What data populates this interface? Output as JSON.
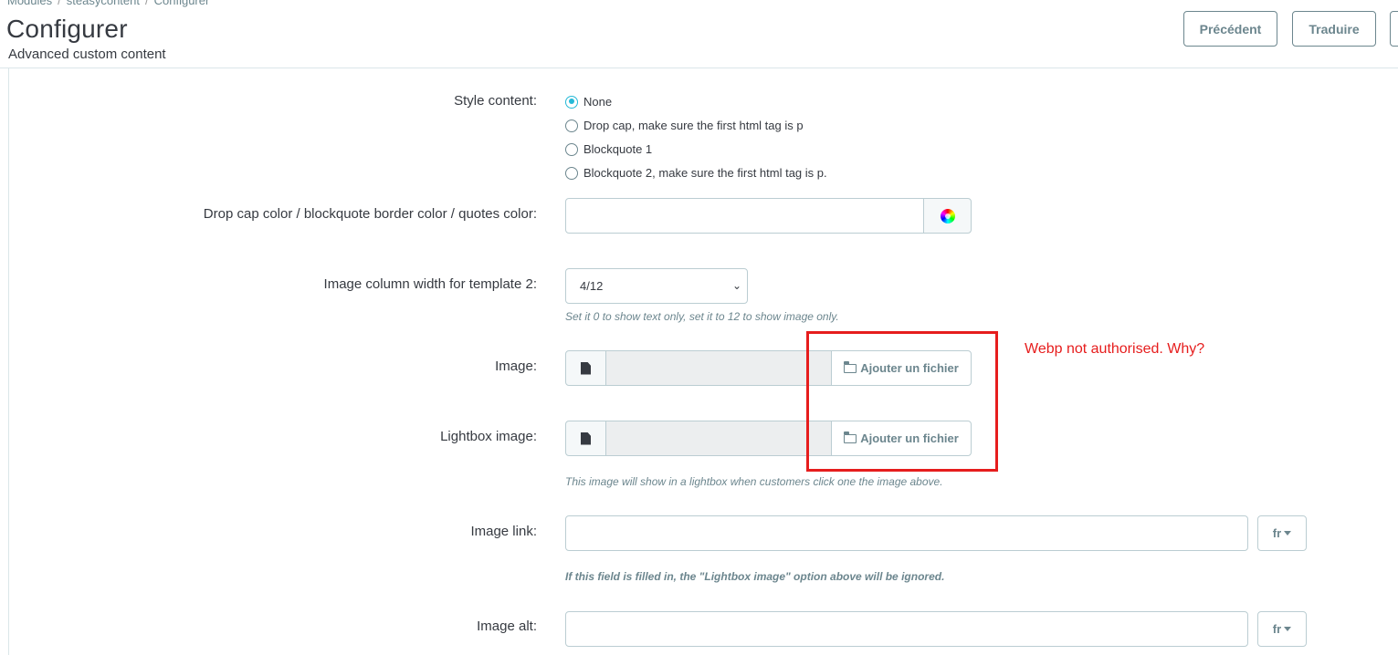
{
  "breadcrumb": {
    "items": [
      "Modules",
      "steasycontent",
      "Configurer"
    ]
  },
  "header": {
    "title": "Configurer",
    "subtitle": "Advanced custom content",
    "buttons": {
      "previous": "Précédent",
      "translate": "Traduire"
    }
  },
  "form": {
    "style_content": {
      "label": "Style content:",
      "options": [
        "None",
        "Drop cap, make sure the first html tag is p",
        "Blockquote 1",
        "Blockquote 2, make sure the first html tag is p."
      ],
      "selected": "None"
    },
    "dropcap_color": {
      "label": "Drop cap color / blockquote border color / quotes color:",
      "value": "",
      "icon": "color-picker-icon"
    },
    "image_width": {
      "label": "Image column width for template 2:",
      "value": "4/12",
      "help": "Set it 0 to show text only, set it to 12 to show image only."
    },
    "image": {
      "label": "Image:",
      "button": "Ajouter un fichier",
      "icon": "file-icon"
    },
    "lightbox_image": {
      "label": "Lightbox image:",
      "button": "Ajouter un fichier",
      "help": "This image will show in a lightbox when customers click one the image above."
    },
    "image_link": {
      "label": "Image link:",
      "value": "",
      "lang": "fr",
      "help": "If this field is filled in, the \"Lightbox image\" option above will be ignored."
    },
    "image_alt": {
      "label": "Image alt:",
      "value": "",
      "lang": "fr"
    }
  },
  "annotation": {
    "text": "Webp not authorised. Why?",
    "color": "#e61d1d"
  },
  "colors": {
    "accent": "#25b9d7",
    "muted": "#6c868e",
    "border": "#bbcdd2"
  }
}
